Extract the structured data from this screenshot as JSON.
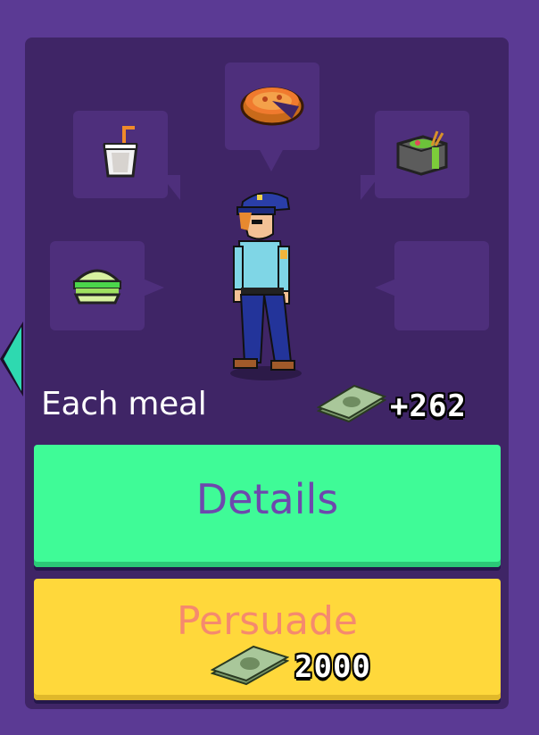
{
  "meal_card": {
    "each_meal_label": "Each meal",
    "income": "+262",
    "details_label": "Details",
    "persuade_label": "Persuade",
    "persuade_cost": "2000"
  },
  "meals": [
    {
      "name": "drink-cup-icon"
    },
    {
      "name": "pizza-pie-icon"
    },
    {
      "name": "sushi-box-icon"
    },
    {
      "name": "green-burger-icon"
    },
    {
      "name": "empty-slot"
    }
  ],
  "character": {
    "name": "police-officer-character"
  },
  "colors": {
    "background": "#5b3a94",
    "panel": "#3f2566",
    "details_button": "#3ffb97",
    "persuade_button": "#ffd83b"
  }
}
